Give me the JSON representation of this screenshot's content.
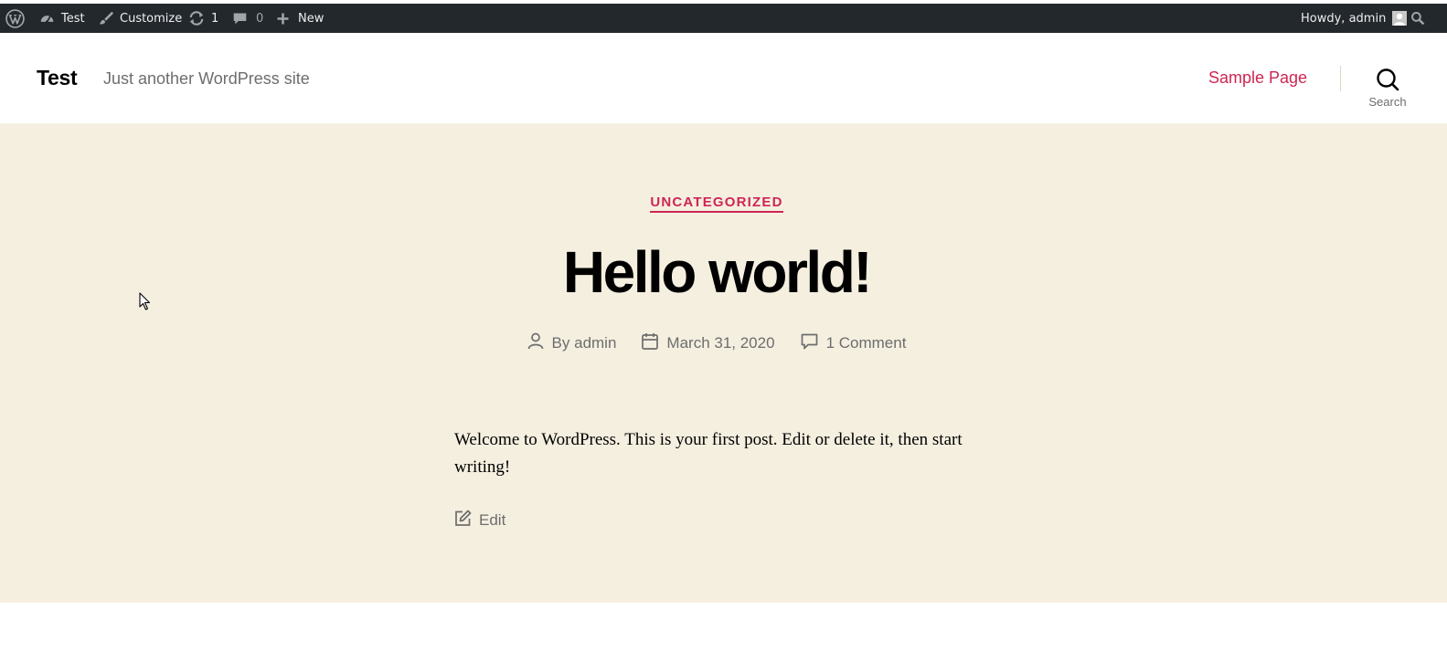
{
  "admin_bar": {
    "site_name": "Test",
    "customize_label": "Customize",
    "updates_count": "1",
    "comments_count": "0",
    "new_label": "New",
    "greeting": "Howdy, admin"
  },
  "header": {
    "site_title": "Test",
    "site_description": "Just another WordPress site",
    "nav_items": [
      "Sample Page"
    ],
    "search_label": "Search"
  },
  "post": {
    "category": "UNCATEGORIZED",
    "title": "Hello world!",
    "author_prefix": "By ",
    "author": "admin",
    "date": "March 31, 2020",
    "comments": "1 Comment",
    "content": "Welcome to WordPress. This is your first post. Edit or delete it, then start writing!",
    "edit_label": "Edit"
  },
  "colors": {
    "admin_bar_bg": "#23282d",
    "accent": "#cd2653",
    "hero_bg": "#f5efe0",
    "meta_text": "#6d6d6d"
  },
  "icons": {
    "admin_bar": [
      "wordpress-logo-icon",
      "dashboard-icon",
      "brush-icon",
      "updates-icon",
      "comment-icon",
      "plus-icon",
      "search-icon"
    ],
    "meta": [
      "user-icon",
      "calendar-icon",
      "comment-icon"
    ],
    "edit": "edit-icon"
  }
}
